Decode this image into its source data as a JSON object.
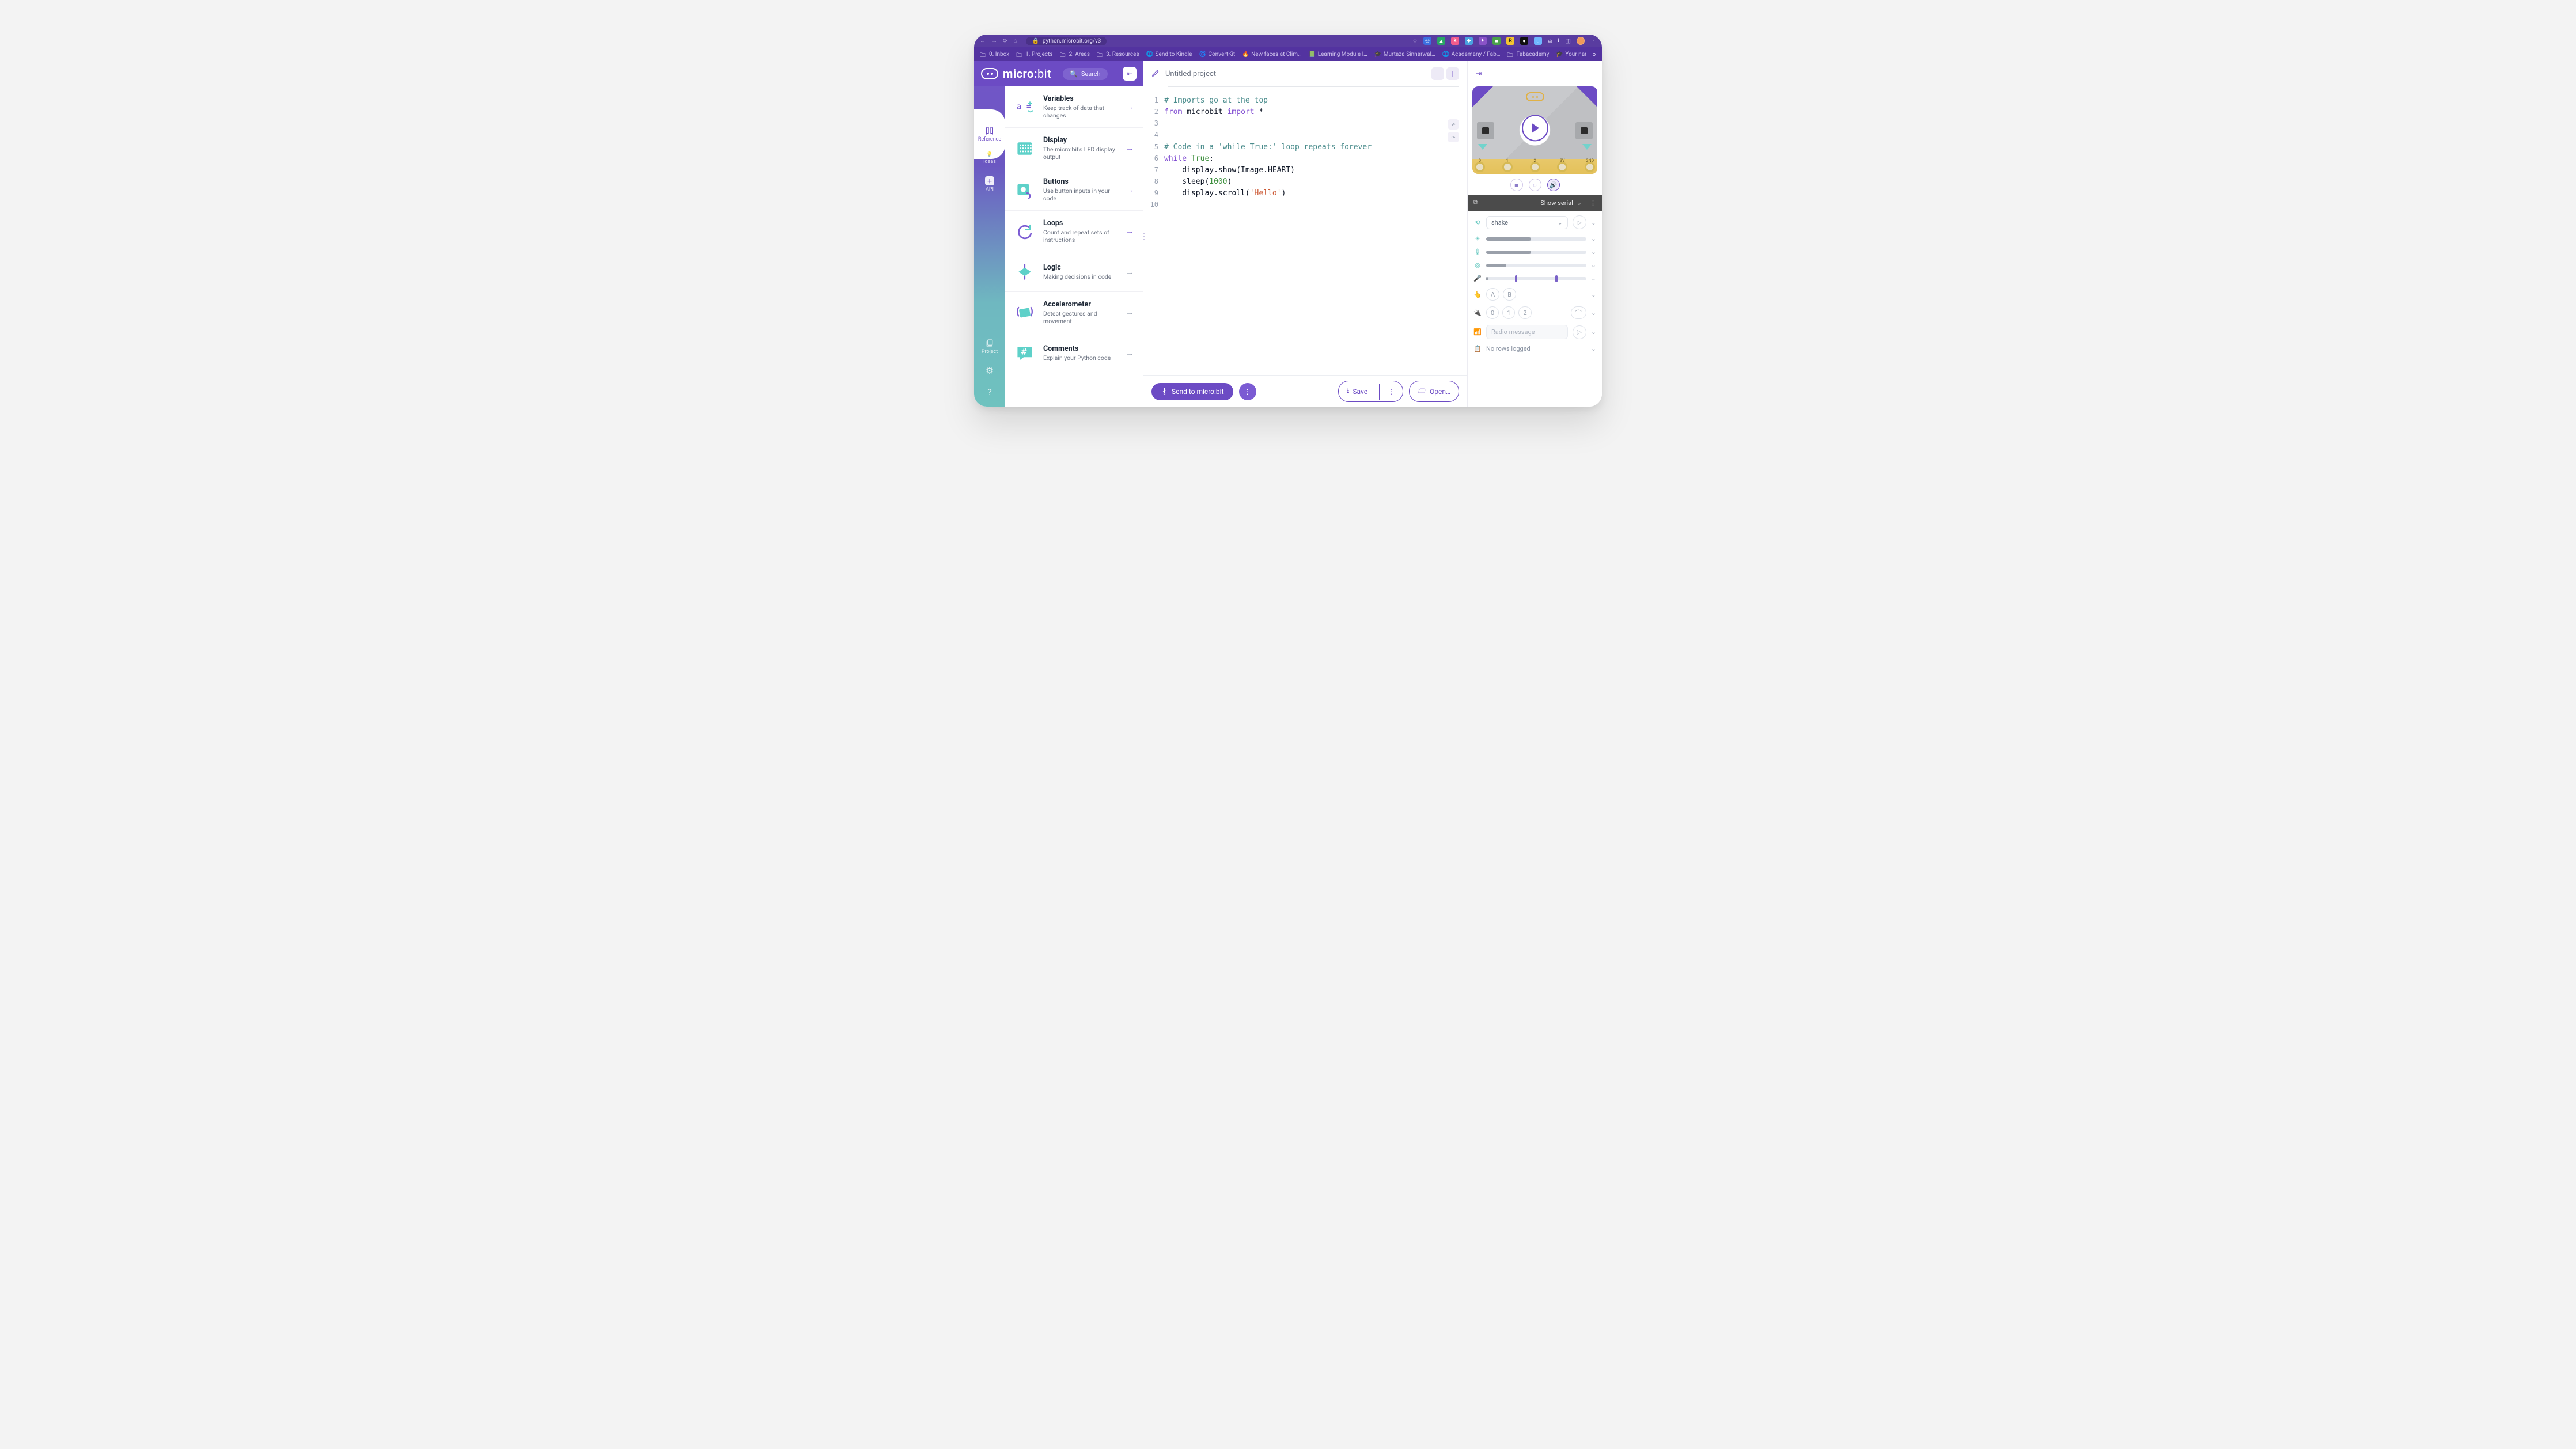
{
  "browser": {
    "url": "python.microbit.org/v3",
    "bookmarks": [
      {
        "icon": "folder",
        "label": "0. Inbox"
      },
      {
        "icon": "folder",
        "label": "1. Projects"
      },
      {
        "icon": "folder",
        "label": "2. Areas"
      },
      {
        "icon": "folder",
        "label": "3. Resources"
      },
      {
        "icon": "globe",
        "label": "Send to Kindle"
      },
      {
        "icon": "swirl",
        "label": "ConvertKit"
      },
      {
        "icon": "dot",
        "label": "New faces at Clim…"
      },
      {
        "icon": "green",
        "label": "Learning Module |…"
      },
      {
        "icon": "grad",
        "label": "Murtaza Sinnarwal…"
      },
      {
        "icon": "globe",
        "label": "Academany / Fab…"
      },
      {
        "icon": "folder",
        "label": "Fabacademy"
      },
      {
        "icon": "grad",
        "label": "Your name - Fab A…"
      }
    ]
  },
  "header": {
    "brand_a": "micro:",
    "brand_b": "bit",
    "search_placeholder": "Search"
  },
  "rail": {
    "reference": "Reference",
    "ideas": "Ideas",
    "api": "API",
    "project": "Project"
  },
  "reference": {
    "items": [
      {
        "key": "variables",
        "title": "Variables",
        "desc": "Keep track of data that changes"
      },
      {
        "key": "display",
        "title": "Display",
        "desc": "The micro:bit's LED display output"
      },
      {
        "key": "buttons",
        "title": "Buttons",
        "desc": "Use button inputs in your code"
      },
      {
        "key": "loops",
        "title": "Loops",
        "desc": "Count and repeat sets of instructions"
      },
      {
        "key": "logic",
        "title": "Logic",
        "desc": "Making decisions in code"
      },
      {
        "key": "accelerometer",
        "title": "Accelerometer",
        "desc": "Detect gestures and movement"
      },
      {
        "key": "comments",
        "title": "Comments",
        "desc": "Explain your Python code"
      }
    ]
  },
  "editor": {
    "project_name": "Untitled project",
    "send_label": "Send to micro:bit",
    "save_label": "Save",
    "open_label": "Open…",
    "code": {
      "l1_comment": "# Imports go at the top",
      "l2_from": "from",
      "l2_mod": " microbit ",
      "l2_import": "import",
      "l2_star": " *",
      "l5_comment": "# Code in a 'while True:' loop repeats forever",
      "l6_while": "while",
      "l6_true": " True",
      "l6_colon": ":",
      "l7": "    display.show(Image.HEART)",
      "l8_a": "    sleep(",
      "l8_num": "1000",
      "l8_b": ")",
      "l9_a": "    display.scroll(",
      "l9_str": "'Hello'",
      "l9_b": ")"
    }
  },
  "sim": {
    "pins": [
      "0",
      "1",
      "2",
      "3V",
      "GND"
    ],
    "serial_label": "Show serial",
    "gesture": "shake",
    "buttons": {
      "a": "A",
      "b": "B"
    },
    "pin_pills": [
      "0",
      "1",
      "2"
    ],
    "radio_placeholder": "Radio message",
    "log_text": "No rows logged",
    "sliders": {
      "light": 45,
      "temp": 45,
      "compass": 20,
      "mic": 30
    }
  }
}
